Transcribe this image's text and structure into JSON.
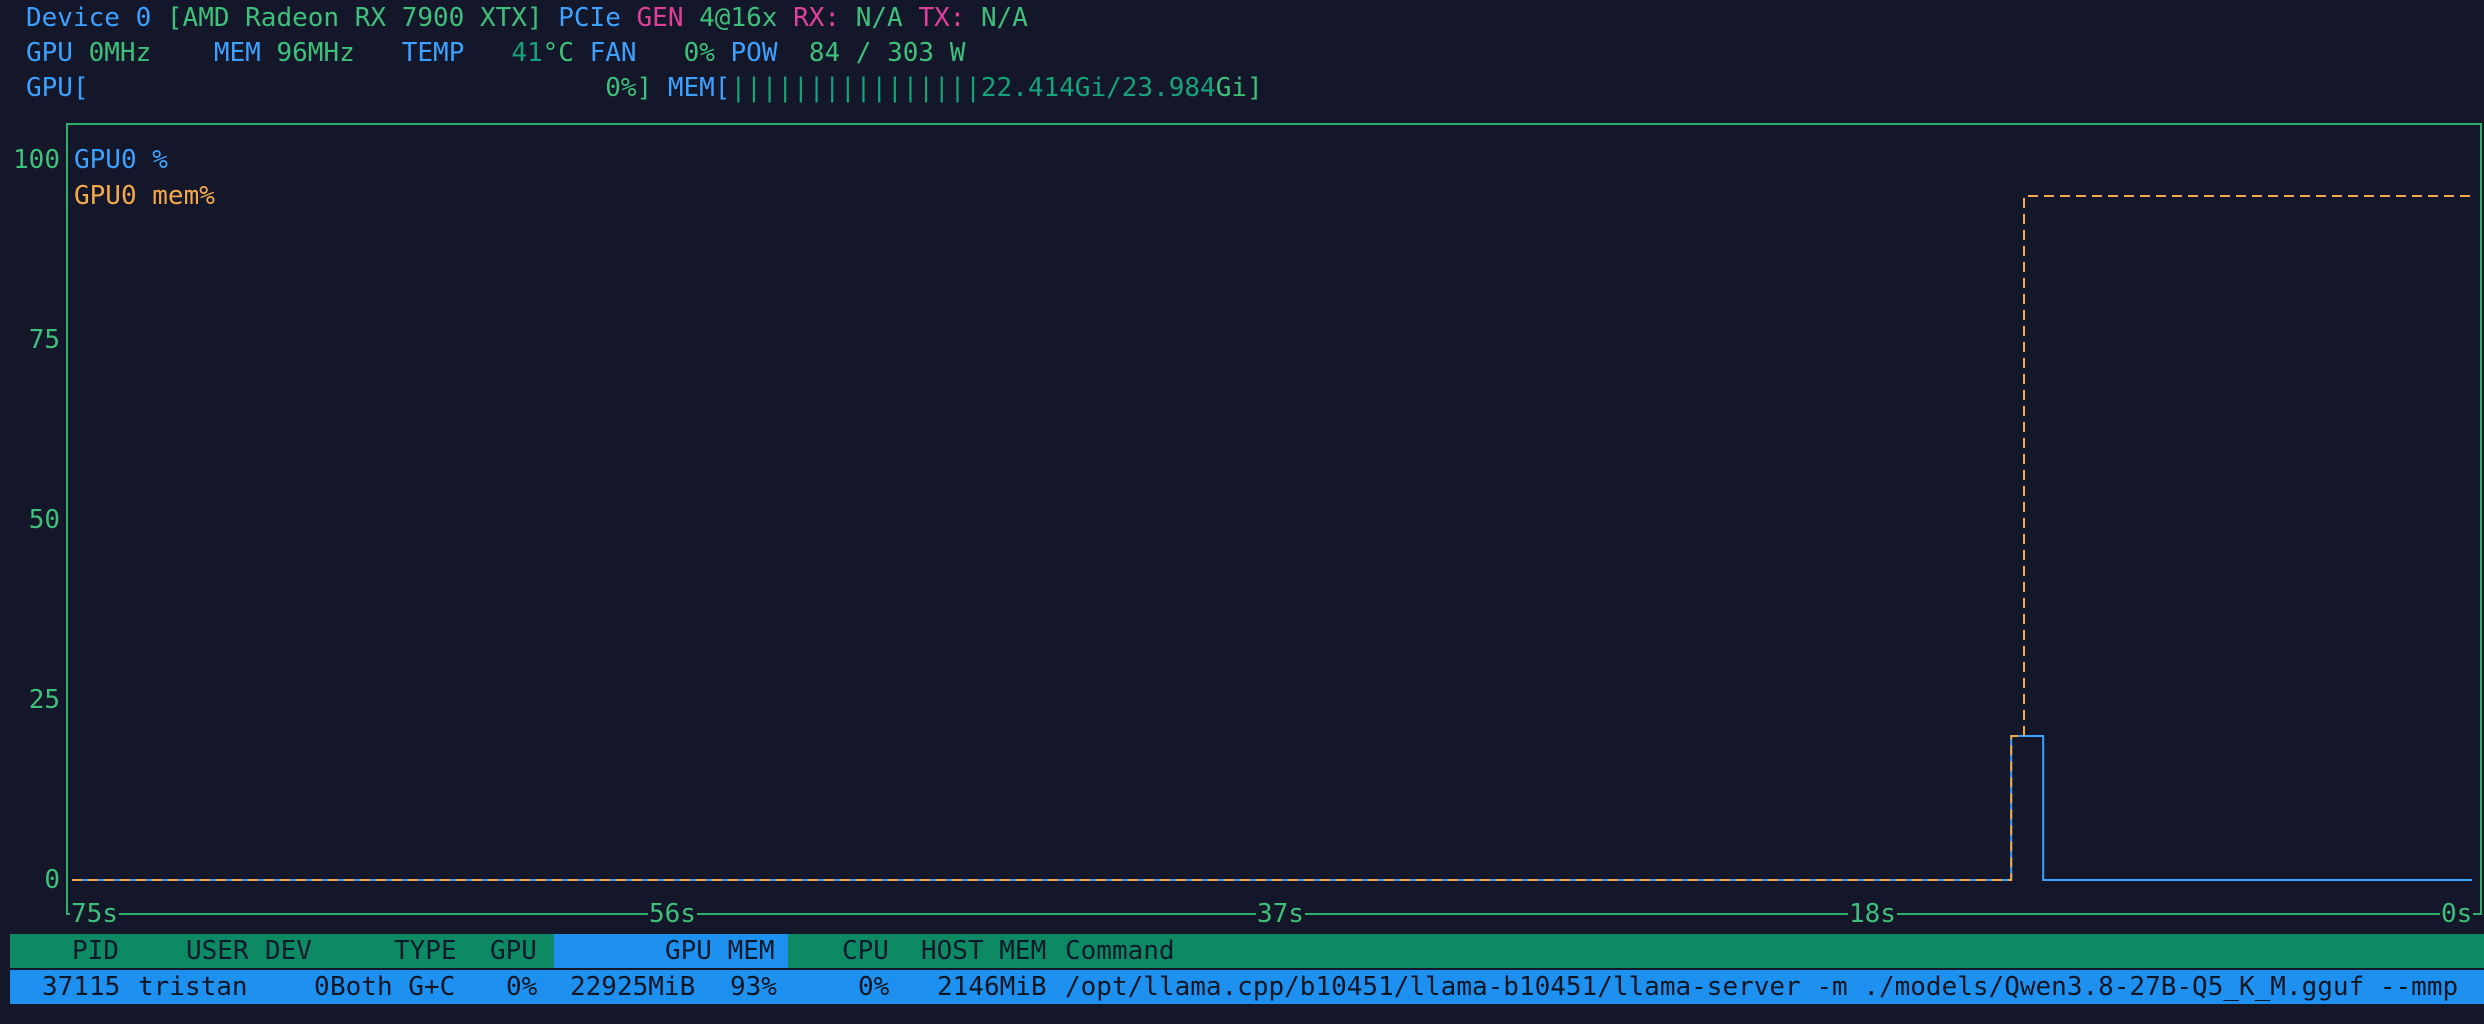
{
  "device": {
    "label": "Device",
    "index": "0",
    "name": "[AMD Radeon RX 7900 XTX]",
    "pcie_label": "PCIe",
    "gen_label": "GEN",
    "gen_value": "4@16x",
    "rx_label": "RX:",
    "rx_value": "N/A",
    "tx_label": "TX:",
    "tx_value": "N/A"
  },
  "stats": {
    "gpu_clock_label": "GPU",
    "gpu_clock_value": "0MHz",
    "mem_clock_label": "MEM",
    "mem_clock_value": "96MHz",
    "temp_label": "TEMP",
    "temp_value": "41",
    "temp_unit": "°C",
    "fan_label": "FAN",
    "fan_value": "0%",
    "pow_label": "POW",
    "pow_value": "84 / 303 W"
  },
  "bars": {
    "gpu_label": "GPU[",
    "gpu_value": "0%]",
    "mem_label": "MEM[",
    "mem_fill": "||||||||||||||||",
    "mem_used": "22.414Gi/23.984",
    "mem_unit": "Gi]"
  },
  "chart_data": {
    "type": "line",
    "yticks": [
      "100",
      "75",
      "50",
      "25",
      "0"
    ],
    "ylim": [
      0,
      100
    ],
    "xticks": [
      "75s",
      "56s",
      "37s",
      "18s",
      "0s"
    ],
    "xlim": [
      -75,
      0
    ],
    "series": [
      {
        "name": "GPU0 %",
        "color": "#3da1ff",
        "points": [
          [
            -75,
            0
          ],
          [
            -14.4,
            0
          ],
          [
            -14.4,
            20
          ],
          [
            -13.4,
            20
          ],
          [
            -13.4,
            0
          ],
          [
            0,
            0
          ]
        ]
      },
      {
        "name": "GPU0 mem%",
        "color": "#f4a84c",
        "points": [
          [
            -75,
            0
          ],
          [
            -14.4,
            0
          ],
          [
            -14.4,
            20
          ],
          [
            -14.0,
            20
          ],
          [
            -14.0,
            95
          ],
          [
            0,
            95
          ]
        ]
      }
    ]
  },
  "table": {
    "headers": {
      "pid": "PID",
      "user": "USER",
      "dev": "DEV",
      "type": "TYPE",
      "gpu": "GPU",
      "gpu_mem": "GPU MEM",
      "cpu": "CPU",
      "host_mem": "HOST MEM",
      "command": "Command"
    },
    "rows": [
      {
        "pid": "37115",
        "user": "tristan",
        "dev": "0",
        "type": "Both G+C",
        "gpu": "0%",
        "gpu_mem": "22925MiB",
        "gpu_mem_pct": "93%",
        "cpu": "0%",
        "host_mem": "2146MiB",
        "command": "/opt/llama.cpp/b10451/llama-b10451/llama-server -m ./models/Qwen3.8-27B-Q5_K_M.gguf --mmp"
      }
    ]
  }
}
